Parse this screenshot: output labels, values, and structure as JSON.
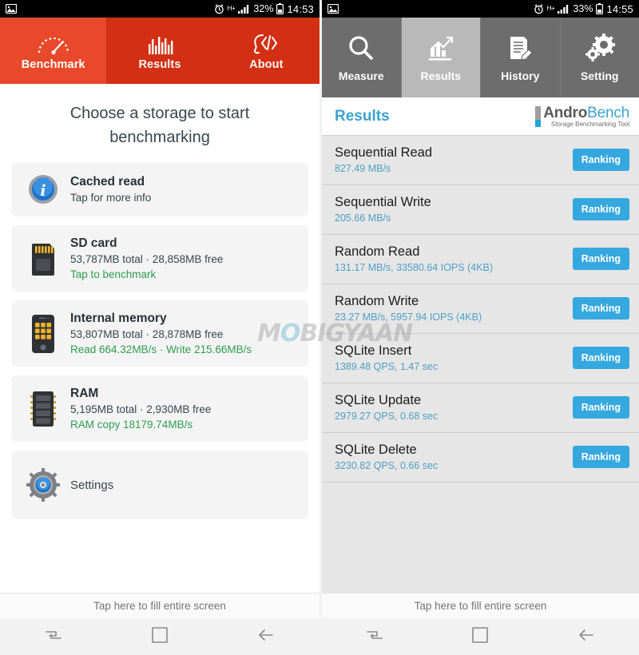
{
  "left": {
    "statusbar": {
      "photo_icon": "image-icon",
      "alarm_icon": "alarm-clock-icon",
      "network": "H+",
      "signal_icon": "signal-bars-icon",
      "battery_pct": "32%",
      "battery_icon": "battery-icon",
      "time": "14:53"
    },
    "tabs": [
      {
        "label": "Benchmark",
        "icon": "speedometer-icon",
        "active": true
      },
      {
        "label": "Results",
        "icon": "bar-chart-icon",
        "active": false
      },
      {
        "label": "About",
        "icon": "code-head-icon",
        "active": false
      }
    ],
    "title": "Choose a storage to start benchmarking",
    "cards": [
      {
        "icon": "info-icon",
        "title": "Cached read",
        "sub": "Tap for more info",
        "action": ""
      },
      {
        "icon": "sdcard-icon",
        "title": "SD card",
        "sub": "53,787MB total · 28,858MB free",
        "action": "Tap to benchmark"
      },
      {
        "icon": "phone-icon",
        "title": "Internal memory",
        "sub": "53,807MB total · 28,878MB free",
        "action": "Read 664.32MB/s · Write 215.66MB/s"
      },
      {
        "icon": "ram-chip-icon",
        "title": "RAM",
        "sub": "5,195MB total · 2,930MB free",
        "action": "RAM copy 18179.74MB/s"
      }
    ],
    "settings_label": "Settings",
    "settings_icon": "gear-icon",
    "fill_screen_label": "Tap here to fill entire screen",
    "nav": [
      {
        "name": "recents-button",
        "icon": "recents-icon"
      },
      {
        "name": "home-button",
        "icon": "home-square-icon"
      },
      {
        "name": "back-button",
        "icon": "back-arrow-icon"
      }
    ]
  },
  "right": {
    "statusbar": {
      "photo_icon": "image-icon",
      "alarm_icon": "alarm-clock-icon",
      "network": "H+",
      "signal_icon": "signal-bars-icon",
      "battery_pct": "33%",
      "battery_icon": "battery-icon",
      "time": "14:55"
    },
    "tabs": [
      {
        "label": "Measure",
        "icon": "magnifier-icon",
        "active": false
      },
      {
        "label": "Results",
        "icon": "chart-up-icon",
        "active": true
      },
      {
        "label": "History",
        "icon": "document-pen-icon",
        "active": false
      },
      {
        "label": "Setting",
        "icon": "gears-icon",
        "active": false
      }
    ],
    "header_title": "Results",
    "logo": {
      "part1": "Andro",
      "part2": "Bench",
      "tagline": "Storage Benchmarking Tool"
    },
    "results": [
      {
        "name": "Sequential Read",
        "value": "827.49 MB/s",
        "button": "Ranking"
      },
      {
        "name": "Sequential Write",
        "value": "205.66 MB/s",
        "button": "Ranking"
      },
      {
        "name": "Random Read",
        "value": "131.17 MB/s, 33580.64 IOPS (4KB)",
        "button": "Ranking"
      },
      {
        "name": "Random Write",
        "value": "23.27 MB/s, 5957.94 IOPS (4KB)",
        "button": "Ranking"
      },
      {
        "name": "SQLite Insert",
        "value": "1389.48 QPS, 1.47 sec",
        "button": "Ranking"
      },
      {
        "name": "SQLite Update",
        "value": "2979.27 QPS, 0.68 sec",
        "button": "Ranking"
      },
      {
        "name": "SQLite Delete",
        "value": "3230.82 QPS, 0.66 sec",
        "button": "Ranking"
      }
    ],
    "fill_screen_label": "Tap here to fill entire screen",
    "nav": [
      {
        "name": "recents-button",
        "icon": "recents-icon"
      },
      {
        "name": "home-button",
        "icon": "home-square-icon"
      },
      {
        "name": "back-button",
        "icon": "back-arrow-icon"
      }
    ]
  },
  "watermark": {
    "part1": "M",
    "part2": "O",
    "part3": "BIGYAAN"
  },
  "colors": {
    "red_active": "#e8492a",
    "red_bar": "#d32f14",
    "green_action": "#2e9e4f",
    "blue_accent": "#35a8df",
    "gray_tab": "#6d6d6d",
    "gray_tab_active": "#b9b9b9"
  }
}
